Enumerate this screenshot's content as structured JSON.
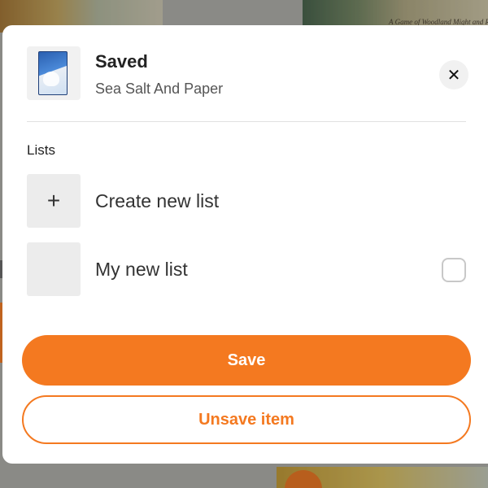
{
  "background": {
    "caption": "A Game of Woodland Might and Rig"
  },
  "modal": {
    "title": "Saved",
    "subtitle": "Sea Salt And Paper",
    "close_icon": "close-icon",
    "thumbnail_icon": "game-box-image"
  },
  "lists": {
    "label": "Lists",
    "create_icon": "+",
    "create_label": "Create new list",
    "items": [
      {
        "label": "My new list",
        "checked": false
      }
    ]
  },
  "actions": {
    "save_label": "Save",
    "unsave_label": "Unsave item"
  },
  "colors": {
    "accent": "#f47920",
    "overlay": "#8a8a86"
  }
}
